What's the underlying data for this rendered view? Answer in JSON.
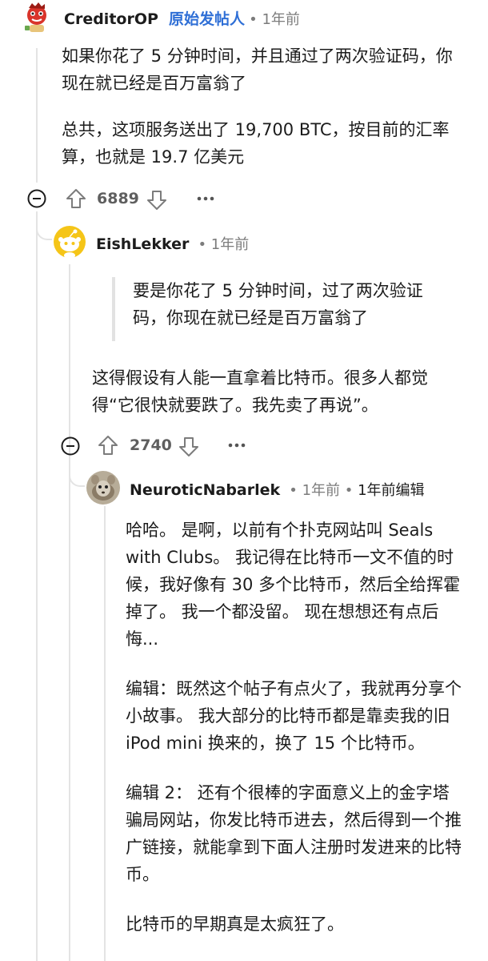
{
  "comment1": {
    "username": "CreditorOP",
    "op_tag": "原始发帖人",
    "time": "1年前",
    "paragraphs": [
      "如果你花了 5 分钟时间，并且通过了两次验证码，你现在就已经是百万富翁了",
      "总共，这项服务送出了 19,700 BTC，按目前的汇率算，也就是 19.7 亿美元"
    ],
    "votes": "6889"
  },
  "comment2": {
    "username": "EishLekker",
    "time": "1年前",
    "quote": "要是你花了 5 分钟时间，过了两次验证码，你现在就已经是百万富翁了",
    "body": "这得假设有人能一直拿着比特币。很多人都觉得“它很快就要跌了。我先卖了再说”。",
    "votes": "2740"
  },
  "comment3": {
    "username": "NeuroticNabarlek",
    "time": "1年前",
    "edited": "1年前编辑",
    "paragraphs": [
      "哈哈。 是啊，以前有个扑克网站叫 Seals with Clubs。 我记得在比特币一文不值的时候，我好像有 30 多个比特币，然后全给挥霍掉了。 我一个都没留。 现在想想还有点后悔...",
      "编辑：既然这个帖子有点火了，我就再分享个小故事。 我大部分的比特币都是靠卖我的旧 iPod mini 换来的，换了 15 个比特币。",
      "编辑 2： 还有个很棒的字面意义上的金字塔骗局网站，你发比特币进去，然后得到一个推广链接，就能拿到下面人注册时发进来的比特币。",
      "比特币的早期真是太疯狂了。"
    ]
  },
  "icons": {
    "collapse": "collapse-minus-icon",
    "upvote": "upvote-arrow-icon",
    "downvote": "downvote-arrow-icon",
    "more": "more-dots-icon"
  },
  "colors": {
    "op_blue": "#2f6fd6",
    "avatar_red": "#d9342b",
    "avatar_yellow": "#f5c518",
    "meta_gray": "#7c7c7c"
  }
}
